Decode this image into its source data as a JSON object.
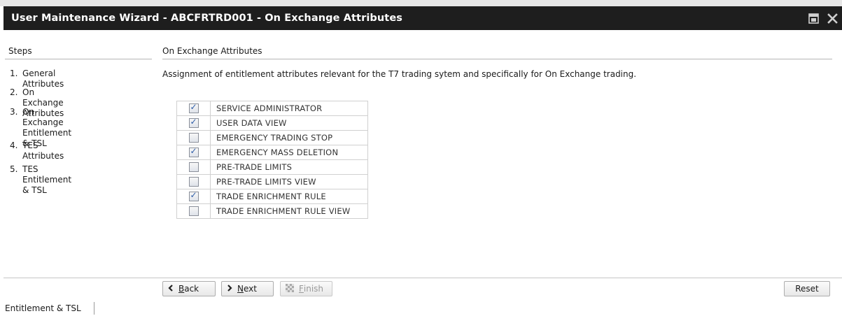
{
  "window": {
    "title": "User Maintenance Wizard  - ABCFRTRD001 - On Exchange Attributes",
    "icons": [
      "restore-window-icon",
      "close-icon"
    ]
  },
  "steps": {
    "header": "Steps",
    "items": [
      {
        "number": "1.",
        "label": "General Attributes"
      },
      {
        "number": "2.",
        "label": "On Exchange Attributes"
      },
      {
        "number": "3.",
        "label_line1": "On Exchange",
        "label_line2": "Entitlement & TSL"
      },
      {
        "number": "4.",
        "label": "TES Attributes"
      },
      {
        "number": "5.",
        "label": "TES Entitlement & TSL"
      }
    ]
  },
  "section": {
    "header": "On Exchange Attributes",
    "description": "Assignment of entitlement attributes relevant for the T7 trading sytem and specifically for On Exchange trading."
  },
  "attributes": [
    {
      "label": "SERVICE ADMINISTRATOR",
      "checked": true
    },
    {
      "label": "USER DATA VIEW",
      "checked": true
    },
    {
      "label": "EMERGENCY TRADING STOP",
      "checked": false
    },
    {
      "label": "EMERGENCY MASS DELETION",
      "checked": true
    },
    {
      "label": "PRE-TRADE LIMITS",
      "checked": false
    },
    {
      "label": "PRE-TRADE LIMITS VIEW",
      "checked": false
    },
    {
      "label": "TRADE ENRICHMENT RULE",
      "checked": true
    },
    {
      "label": "TRADE ENRICHMENT RULE VIEW",
      "checked": false
    }
  ],
  "buttons": {
    "back": {
      "mnemonic": "B",
      "rest": "ack"
    },
    "next": {
      "mnemonic": "N",
      "rest": "ext"
    },
    "finish": {
      "mnemonic": "F",
      "rest": "inish",
      "disabled": true
    },
    "reset": "Reset"
  },
  "status_bar": {
    "text": "Entitlement & TSL"
  }
}
